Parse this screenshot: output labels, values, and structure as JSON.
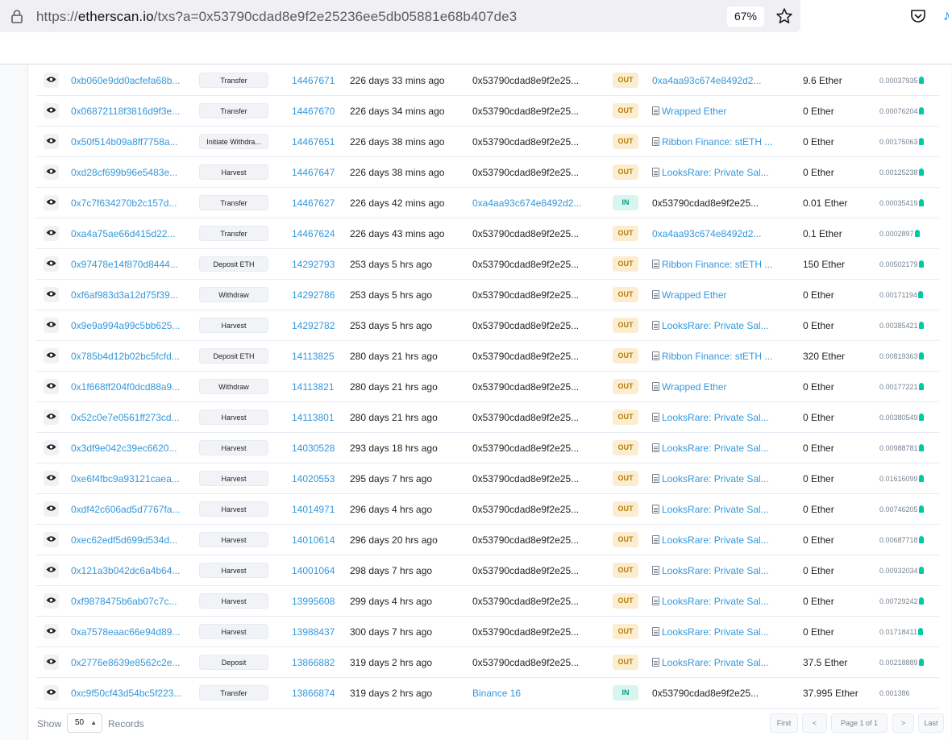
{
  "browser": {
    "url_prefix": "https://",
    "url_host": "etherscan.io",
    "url_path": "/txs?a=0x53790cdad8e9f2e25236ee5db05881e68b407de3",
    "zoom": "67%"
  },
  "rows": [
    {
      "hash": "0xb060e9dd0acfefa68b...",
      "method": "Transfer",
      "block": "14467671",
      "age": "226 days 33 mins ago",
      "from": "0x53790cdad8e9f2e25...",
      "from_link": false,
      "dir": "OUT",
      "to": "0xa4aa93c674e8492d2...",
      "to_link": true,
      "to_contract": false,
      "value": "9.6 Ether",
      "fee": "0.00037935"
    },
    {
      "hash": "0x06872118f3816d9f3e...",
      "method": "Transfer",
      "block": "14467670",
      "age": "226 days 34 mins ago",
      "from": "0x53790cdad8e9f2e25...",
      "from_link": false,
      "dir": "OUT",
      "to": "Wrapped Ether",
      "to_link": true,
      "to_contract": true,
      "value": "0 Ether",
      "fee": "0.00076204"
    },
    {
      "hash": "0x50f514b09a8ff7758a...",
      "method": "Initiate Withdra...",
      "block": "14467651",
      "age": "226 days 38 mins ago",
      "from": "0x53790cdad8e9f2e25...",
      "from_link": false,
      "dir": "OUT",
      "to": "Ribbon Finance: stETH ...",
      "to_link": true,
      "to_contract": true,
      "value": "0 Ether",
      "fee": "0.00175063"
    },
    {
      "hash": "0xd28cf699b96e5483e...",
      "method": "Harvest",
      "block": "14467647",
      "age": "226 days 38 mins ago",
      "from": "0x53790cdad8e9f2e25...",
      "from_link": false,
      "dir": "OUT",
      "to": "LooksRare: Private Sal...",
      "to_link": true,
      "to_contract": true,
      "value": "0 Ether",
      "fee": "0.00125238"
    },
    {
      "hash": "0x7c7f634270b2c157d...",
      "method": "Transfer",
      "block": "14467627",
      "age": "226 days 42 mins ago",
      "from": "0xa4aa93c674e8492d2...",
      "from_link": true,
      "dir": "IN",
      "to": "0x53790cdad8e9f2e25...",
      "to_link": false,
      "to_contract": false,
      "value": "0.01 Ether",
      "fee": "0.00035419"
    },
    {
      "hash": "0xa4a75ae66d415d22...",
      "method": "Transfer",
      "block": "14467624",
      "age": "226 days 43 mins ago",
      "from": "0x53790cdad8e9f2e25...",
      "from_link": false,
      "dir": "OUT",
      "to": "0xa4aa93c674e8492d2...",
      "to_link": true,
      "to_contract": false,
      "value": "0.1 Ether",
      "fee": "0.0002897"
    },
    {
      "hash": "0x97478e14f870d8444...",
      "method": "Deposit ETH",
      "block": "14292793",
      "age": "253 days 5 hrs ago",
      "from": "0x53790cdad8e9f2e25...",
      "from_link": false,
      "dir": "OUT",
      "to": "Ribbon Finance: stETH ...",
      "to_link": true,
      "to_contract": true,
      "value": "150 Ether",
      "fee": "0.00502179"
    },
    {
      "hash": "0xf6af983d3a12d75f39...",
      "method": "Withdraw",
      "block": "14292786",
      "age": "253 days 5 hrs ago",
      "from": "0x53790cdad8e9f2e25...",
      "from_link": false,
      "dir": "OUT",
      "to": "Wrapped Ether",
      "to_link": true,
      "to_contract": true,
      "value": "0 Ether",
      "fee": "0.00171194"
    },
    {
      "hash": "0x9e9a994a99c5bb625...",
      "method": "Harvest",
      "block": "14292782",
      "age": "253 days 5 hrs ago",
      "from": "0x53790cdad8e9f2e25...",
      "from_link": false,
      "dir": "OUT",
      "to": "LooksRare: Private Sal...",
      "to_link": true,
      "to_contract": true,
      "value": "0 Ether",
      "fee": "0.00385421"
    },
    {
      "hash": "0x785b4d12b02bc5fcfd...",
      "method": "Deposit ETH",
      "block": "14113825",
      "age": "280 days 21 hrs ago",
      "from": "0x53790cdad8e9f2e25...",
      "from_link": false,
      "dir": "OUT",
      "to": "Ribbon Finance: stETH ...",
      "to_link": true,
      "to_contract": true,
      "value": "320 Ether",
      "fee": "0.00819363"
    },
    {
      "hash": "0x1f668ff204f0dcd88a9...",
      "method": "Withdraw",
      "block": "14113821",
      "age": "280 days 21 hrs ago",
      "from": "0x53790cdad8e9f2e25...",
      "from_link": false,
      "dir": "OUT",
      "to": "Wrapped Ether",
      "to_link": true,
      "to_contract": true,
      "value": "0 Ether",
      "fee": "0.00177221"
    },
    {
      "hash": "0x52c0e7e0561ff273cd...",
      "method": "Harvest",
      "block": "14113801",
      "age": "280 days 21 hrs ago",
      "from": "0x53790cdad8e9f2e25...",
      "from_link": false,
      "dir": "OUT",
      "to": "LooksRare: Private Sal...",
      "to_link": true,
      "to_contract": true,
      "value": "0 Ether",
      "fee": "0.00380549"
    },
    {
      "hash": "0x3df9e042c39ec6620...",
      "method": "Harvest",
      "block": "14030528",
      "age": "293 days 18 hrs ago",
      "from": "0x53790cdad8e9f2e25...",
      "from_link": false,
      "dir": "OUT",
      "to": "LooksRare: Private Sal...",
      "to_link": true,
      "to_contract": true,
      "value": "0 Ether",
      "fee": "0.00988781"
    },
    {
      "hash": "0xe6f4fbc9a93121caea...",
      "method": "Harvest",
      "block": "14020553",
      "age": "295 days 7 hrs ago",
      "from": "0x53790cdad8e9f2e25...",
      "from_link": false,
      "dir": "OUT",
      "to": "LooksRare: Private Sal...",
      "to_link": true,
      "to_contract": true,
      "value": "0 Ether",
      "fee": "0.01616099"
    },
    {
      "hash": "0xdf42c606ad5d7767fa...",
      "method": "Harvest",
      "block": "14014971",
      "age": "296 days 4 hrs ago",
      "from": "0x53790cdad8e9f2e25...",
      "from_link": false,
      "dir": "OUT",
      "to": "LooksRare: Private Sal...",
      "to_link": true,
      "to_contract": true,
      "value": "0 Ether",
      "fee": "0.00746205"
    },
    {
      "hash": "0xec62edf5d699d534d...",
      "method": "Harvest",
      "block": "14010614",
      "age": "296 days 20 hrs ago",
      "from": "0x53790cdad8e9f2e25...",
      "from_link": false,
      "dir": "OUT",
      "to": "LooksRare: Private Sal...",
      "to_link": true,
      "to_contract": true,
      "value": "0 Ether",
      "fee": "0.00687718"
    },
    {
      "hash": "0x121a3b042dc6a4b64...",
      "method": "Harvest",
      "block": "14001064",
      "age": "298 days 7 hrs ago",
      "from": "0x53790cdad8e9f2e25...",
      "from_link": false,
      "dir": "OUT",
      "to": "LooksRare: Private Sal...",
      "to_link": true,
      "to_contract": true,
      "value": "0 Ether",
      "fee": "0.00932034"
    },
    {
      "hash": "0xf9878475b6ab07c7c...",
      "method": "Harvest",
      "block": "13995608",
      "age": "299 days 4 hrs ago",
      "from": "0x53790cdad8e9f2e25...",
      "from_link": false,
      "dir": "OUT",
      "to": "LooksRare: Private Sal...",
      "to_link": true,
      "to_contract": true,
      "value": "0 Ether",
      "fee": "0.00729242"
    },
    {
      "hash": "0xa7578eaac66e94d89...",
      "method": "Harvest",
      "block": "13988437",
      "age": "300 days 7 hrs ago",
      "from": "0x53790cdad8e9f2e25...",
      "from_link": false,
      "dir": "OUT",
      "to": "LooksRare: Private Sal...",
      "to_link": true,
      "to_contract": true,
      "value": "0 Ether",
      "fee": "0.01718411"
    },
    {
      "hash": "0x2776e8639e8562c2e...",
      "method": "Deposit",
      "block": "13866882",
      "age": "319 days 2 hrs ago",
      "from": "0x53790cdad8e9f2e25...",
      "from_link": false,
      "dir": "OUT",
      "to": "LooksRare: Private Sal...",
      "to_link": true,
      "to_contract": true,
      "value": "37.5 Ether",
      "fee": "0.00218889"
    },
    {
      "hash": "0xc9f50cf43d54bc5f223...",
      "method": "Transfer",
      "block": "13866874",
      "age": "319 days 2 hrs ago",
      "from": "Binance 16",
      "from_link": true,
      "dir": "IN",
      "to": "0x53790cdad8e9f2e25...",
      "to_link": false,
      "to_contract": false,
      "value": "37.995 Ether",
      "fee": "0.001386",
      "fee_no_bulb": true
    }
  ],
  "footer": {
    "show_label": "Show",
    "records_value": "50",
    "records_label": "Records",
    "first": "First",
    "prev": "<",
    "page": "Page 1 of 1",
    "next": ">",
    "last": "Last"
  },
  "colors": {
    "link": "#3498db",
    "out_bg": "#fcecd0",
    "in_bg": "#d9f5ef",
    "gas_bulb": "#00c9a7"
  }
}
